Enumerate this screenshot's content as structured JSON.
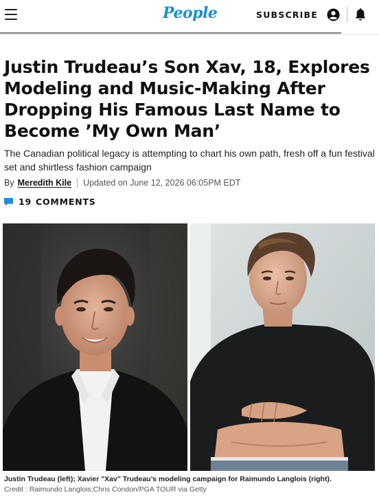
{
  "header": {
    "logo_text": "People",
    "subscribe_label": "SUBSCRIBE",
    "menu_icon": "hamburger-menu-icon",
    "account_icon": "account-circle-icon",
    "bell_icon": "notification-bell-icon",
    "logo_color": "#1a8fd6"
  },
  "article": {
    "headline": "Justin Trudeau’s Son Xav, 18, Explores Modeling and Music-Making After Dropping His Famous Last Name to Become ’My Own Man’",
    "dek": "The Canadian political legacy is attempting to chart his own path, fresh off a fun festival set and shirtless fashion campaign",
    "byline": {
      "by": "By",
      "author": "Meredith Kile",
      "updated": "Updated on June 12, 2026 06:05PM EDT"
    },
    "comments": {
      "icon": "comment-bubble-icon",
      "count": "19",
      "label": "COMMENTS",
      "icon_color": "#1a8fd6"
    },
    "images": {
      "caption": "Justin Trudeau (left); Xavier \"Xav\" Trudeau’s modeling campaign for Raimundo Langlois (right).",
      "credit": "Credit : Raimundo Langlois;Chris Condon/PGA TOUR via Getty"
    }
  }
}
